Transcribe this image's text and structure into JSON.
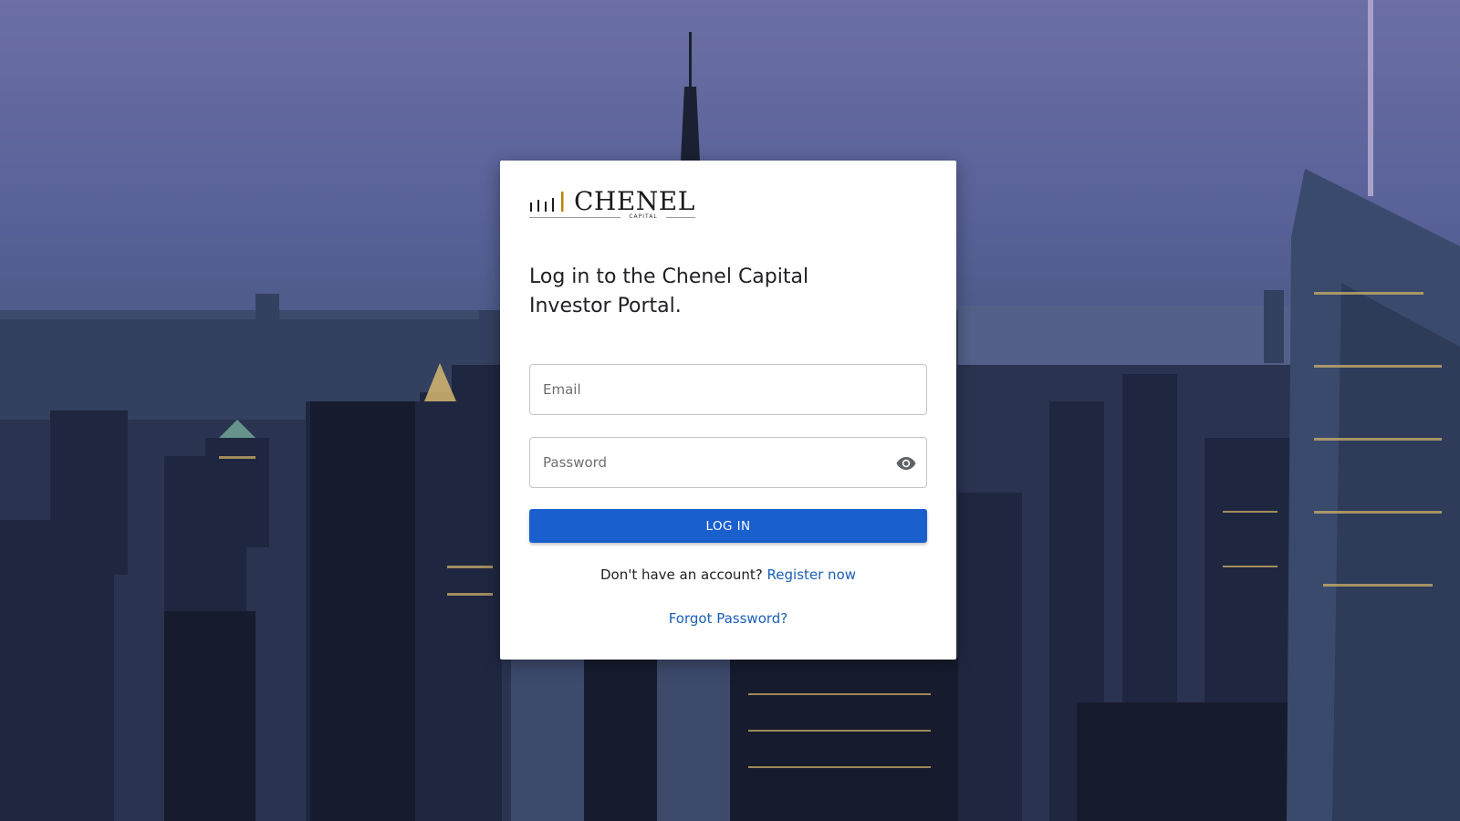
{
  "brand": {
    "name": "CHENEL",
    "subtitle": "CAPITAL",
    "accent_color": "#b8860b"
  },
  "login": {
    "heading": "Log in to the Chenel Capital Investor Portal.",
    "email_placeholder": "Email",
    "password_placeholder": "Password",
    "submit_label": "LOG IN",
    "no_account_text": "Don't have an account?",
    "register_link": "Register now",
    "forgot_link": "Forgot Password?",
    "button_color": "#1a5fce"
  },
  "background": {
    "description_icon": "city-skyline-icon"
  }
}
